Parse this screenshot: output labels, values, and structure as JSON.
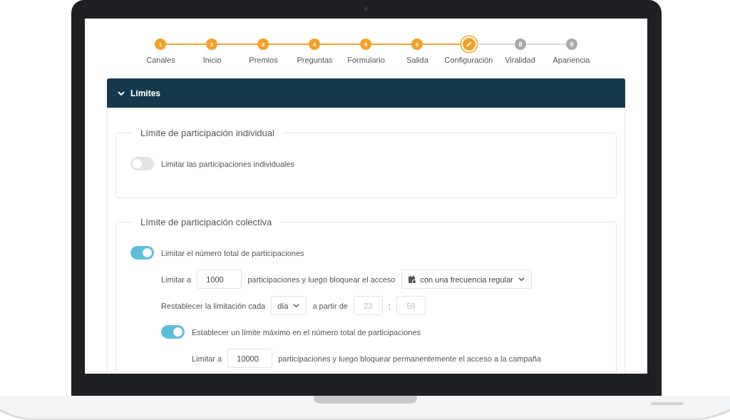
{
  "steps": [
    {
      "number": "1",
      "label": "Canales",
      "kind": "done"
    },
    {
      "number": "2",
      "label": "Inicio",
      "kind": "done"
    },
    {
      "number": "3",
      "label": "Premios",
      "kind": "done"
    },
    {
      "number": "4",
      "label": "Preguntas",
      "kind": "done"
    },
    {
      "number": "5",
      "label": "Formulario",
      "kind": "done"
    },
    {
      "number": "6",
      "label": "Salida",
      "kind": "done"
    },
    {
      "label": "Configuración",
      "kind": "current"
    },
    {
      "number": "8",
      "label": "Viralidad",
      "kind": "pending"
    },
    {
      "number": "9",
      "label": "Apariencia",
      "kind": "pending"
    }
  ],
  "panel": {
    "title": "Límites",
    "expanded": true
  },
  "individual": {
    "legend": "Límite de participación individual",
    "toggle": {
      "label": "Limitar las participaciones individuales",
      "on": false
    }
  },
  "collective": {
    "legend": "Límite de participación colectiva",
    "toggle": {
      "label": "Limitar el número total de participaciones",
      "on": true
    },
    "limit_row": {
      "prefix": "Limitar a",
      "value": "1000",
      "suffix": "participaciones y luego bloquear el acceso",
      "frequency": "con una frecuencia regular"
    },
    "reset_row": {
      "prefix": "Restablecer la limitación cada",
      "period": "día",
      "from": "a partir de",
      "hour": {
        "placeholder": "23"
      },
      "separator": ":",
      "minute": {
        "placeholder": "59"
      }
    },
    "max_toggle": {
      "label": "Establecer un límite máximo en el número total de participaciones",
      "on": true
    },
    "max_row": {
      "prefix": "Limitar a",
      "value": "10000",
      "suffix": "participaciones y luego bloquear permanentemente el acceso a la campaña"
    }
  }
}
